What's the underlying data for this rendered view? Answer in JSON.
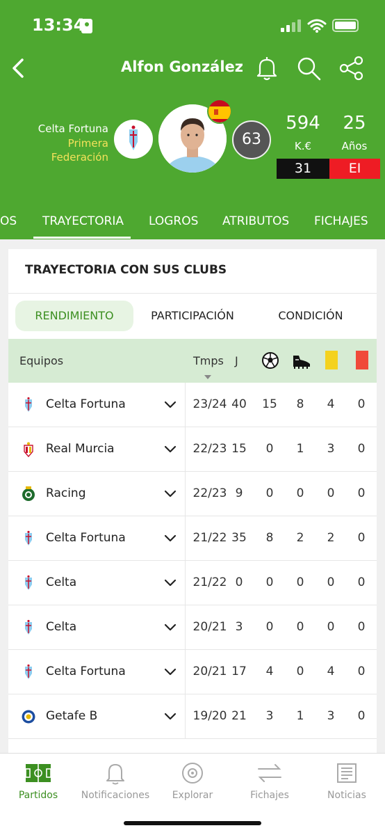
{
  "status": {
    "time": "13:34"
  },
  "header": {
    "player_name": "Alfon González",
    "team": "Celta Fortuna",
    "league": "Primera Federación",
    "rating": "63",
    "value": "594",
    "value_unit": "K.€",
    "age": "25",
    "age_label": "Años",
    "number": "31",
    "position": "EI",
    "colors": {
      "green": "#4ea830",
      "yellow": "#f4e25a",
      "position_red": "#ee1c24"
    }
  },
  "tabs": [
    {
      "label": "OS"
    },
    {
      "label": "TRAYECTORIA",
      "active": true
    },
    {
      "label": "LOGROS"
    },
    {
      "label": "ATRIBUTOS"
    },
    {
      "label": "FICHAJES"
    }
  ],
  "card": {
    "title": "TRAYECTORIA CON SUS CLUBS",
    "segments": [
      "RENDIMIENTO",
      "PARTICIPACIÓN",
      "CONDICIÓN"
    ],
    "columns": {
      "team": "Equipos",
      "season": "Tmps",
      "games": "J"
    },
    "column_icons": [
      "ball-icon",
      "boot-icon",
      "yellow-card-icon",
      "red-card-icon"
    ],
    "rows": [
      {
        "team": "Celta Fortuna",
        "season": "23/24",
        "j": "40",
        "goals": "15",
        "assists": "8",
        "yellow": "4",
        "red": "0",
        "crest": "celta"
      },
      {
        "team": "Real Murcia",
        "season": "22/23",
        "j": "15",
        "goals": "0",
        "assists": "1",
        "yellow": "3",
        "red": "0",
        "crest": "murcia"
      },
      {
        "team": "Racing",
        "season": "22/23",
        "j": "9",
        "goals": "0",
        "assists": "0",
        "yellow": "0",
        "red": "0",
        "crest": "racing"
      },
      {
        "team": "Celta Fortuna",
        "season": "21/22",
        "j": "35",
        "goals": "8",
        "assists": "2",
        "yellow": "2",
        "red": "0",
        "crest": "celta"
      },
      {
        "team": "Celta",
        "season": "21/22",
        "j": "0",
        "goals": "0",
        "assists": "0",
        "yellow": "0",
        "red": "0",
        "crest": "celta"
      },
      {
        "team": "Celta",
        "season": "20/21",
        "j": "3",
        "goals": "0",
        "assists": "0",
        "yellow": "0",
        "red": "0",
        "crest": "celta"
      },
      {
        "team": "Celta Fortuna",
        "season": "20/21",
        "j": "17",
        "goals": "4",
        "assists": "0",
        "yellow": "4",
        "red": "0",
        "crest": "celta"
      },
      {
        "team": "Getafe B",
        "season": "19/20",
        "j": "21",
        "goals": "3",
        "assists": "1",
        "yellow": "3",
        "red": "0",
        "crest": "getafe"
      }
    ]
  },
  "bottom_nav": [
    {
      "label": "Partidos",
      "icon": "pitch-icon",
      "active": true
    },
    {
      "label": "Notificaciones",
      "icon": "bell-icon"
    },
    {
      "label": "Explorar",
      "icon": "compass-icon"
    },
    {
      "label": "Fichajes",
      "icon": "transfer-icon"
    },
    {
      "label": "Noticias",
      "icon": "news-icon"
    }
  ]
}
